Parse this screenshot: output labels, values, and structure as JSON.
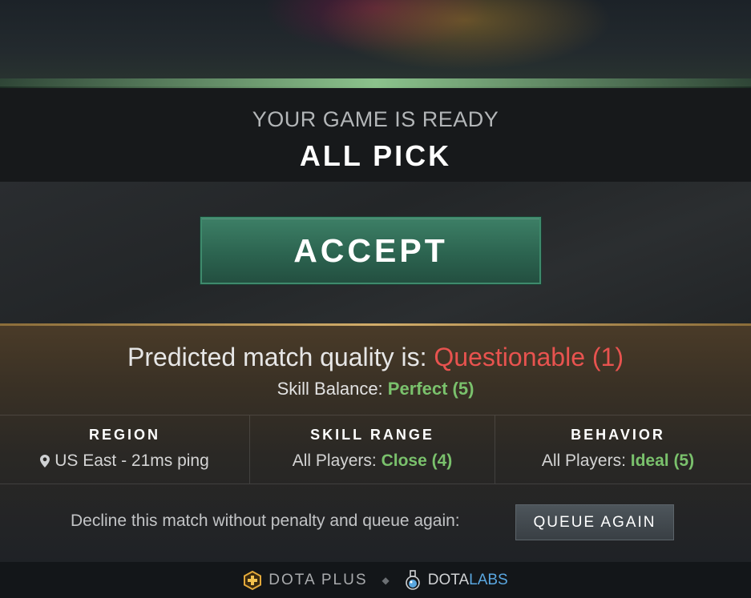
{
  "header": {
    "subtitle": "YOUR GAME IS READY",
    "mode": "ALL PICK"
  },
  "accept_label": "ACCEPT",
  "quality": {
    "prefix": "Predicted match quality is: ",
    "rating": "Questionable (1)",
    "skill_balance_label": "Skill Balance: ",
    "skill_balance_value": "Perfect (5)"
  },
  "columns": {
    "region": {
      "title": "REGION",
      "value": "US East - 21ms ping"
    },
    "skill_range": {
      "title": "SKILL RANGE",
      "label": "All Players: ",
      "value": "Close (4)"
    },
    "behavior": {
      "title": "BEHAVIOR",
      "label": "All Players: ",
      "value": "Ideal (5)"
    }
  },
  "decline_text": "Decline this match without penalty and queue again:",
  "queue_again_label": "QUEUE AGAIN",
  "footer": {
    "dota_plus": "DOTA PLUS",
    "labs_a": "DOTA",
    "labs_b": "LABS"
  },
  "colors": {
    "questionable": "#e8534f",
    "good": "#7ac16c",
    "accept_green": "#2c6450",
    "labs_blue": "#5aa7e0"
  },
  "icons": [
    "location-pin-icon",
    "dota-plus-icon",
    "dota-labs-flask-icon"
  ]
}
